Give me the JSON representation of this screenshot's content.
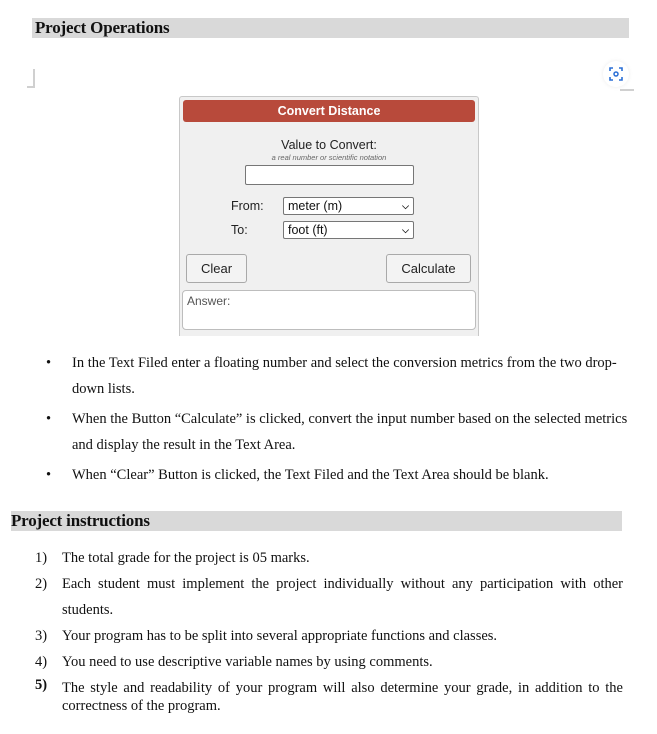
{
  "sections": {
    "operations_heading": "Project Operations",
    "instructions_heading": "Project instructions"
  },
  "widget": {
    "title": "Convert Distance",
    "value_label": "Value to Convert:",
    "value_hint": "a real number or scientific notation",
    "value_input": "",
    "from_label": "From:",
    "from_selected": "meter (m)",
    "to_label": "To:",
    "to_selected": "foot (ft)",
    "clear_button": "Clear",
    "calculate_button": "Calculate",
    "answer_label": "Answer:",
    "accent_color": "#b84a3b"
  },
  "icons": {
    "scan": "screen-capture-icon",
    "dropdown": "chevron-down-icon"
  },
  "operations": [
    {
      "bullet": "•",
      "text": "In the Text Filed enter a floating number and select the conversion metrics from the two drop-down lists."
    },
    {
      "bullet": "•",
      "text": "When the Button “Calculate” is clicked, convert the input number based on the selected metrics and display the result in the Text Area."
    },
    {
      "bullet": "•",
      "text": "When “Clear” Button is clicked, the Text Filed and the Text Area should be blank."
    }
  ],
  "instructions": [
    {
      "num": "1)",
      "text": "The total grade for the project is 05 marks."
    },
    {
      "num": "2)",
      "text": "Each student must implement the project individually without any participation with other students."
    },
    {
      "num": "3)",
      "text": "Your program has to be split into several appropriate functions and classes."
    },
    {
      "num": "4)",
      "text": "You need to use descriptive variable names by using comments."
    },
    {
      "num": "5)",
      "text": "The style and readability of your program will also determine your grade, in addition to the correctness of the program."
    }
  ]
}
